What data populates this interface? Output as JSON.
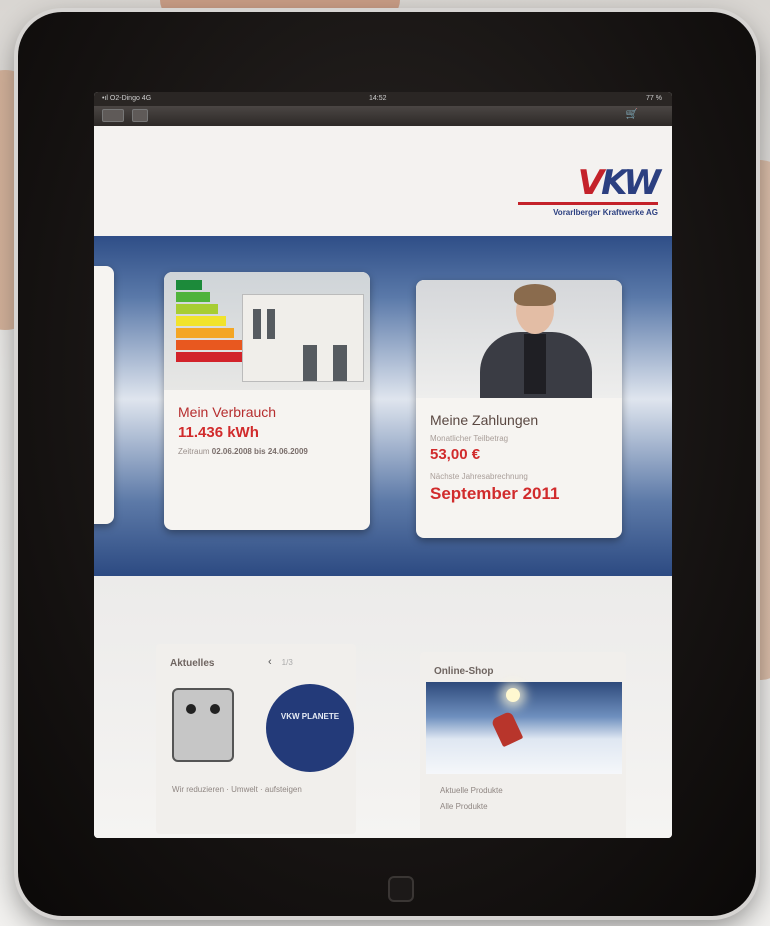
{
  "status_bar": {
    "carrier": "•ıl O2-Dingo 4G",
    "time": "14:52",
    "battery": "77 %"
  },
  "toolbar": {
    "tab_count": ""
  },
  "logo": {
    "mark_v": "V",
    "mark_kw": "KW",
    "subtitle": "Vorarlberger Kraftwerke AG"
  },
  "cards": {
    "verbrauch": {
      "title": "Mein Verbrauch",
      "value": "11.436 kWh",
      "meta_label": "Zeitraum",
      "meta_range": "02.06.2008 bis 24.06.2009"
    },
    "zahlungen": {
      "title": "Meine Zahlungen",
      "label_monthly": "Monatlicher Teilbetrag",
      "amount": "53,00 €",
      "label_next": "Nächste Jahresabrechnung",
      "month": "September 2011"
    }
  },
  "aktuelles": {
    "title": "Aktuelles",
    "prev": "‹",
    "next": "›",
    "page": "1/3",
    "badge": "VKW PLANETE",
    "caption": "Wir reduzieren · Umwelt · aufsteigen"
  },
  "shop": {
    "title": "Online-Shop",
    "link1": "Aktuelle Produkte",
    "link2": "Alle Produkte"
  },
  "colors": {
    "brand_blue": "#2b3f80",
    "brand_red": "#c4222a",
    "accent_red": "#d12b2c"
  }
}
